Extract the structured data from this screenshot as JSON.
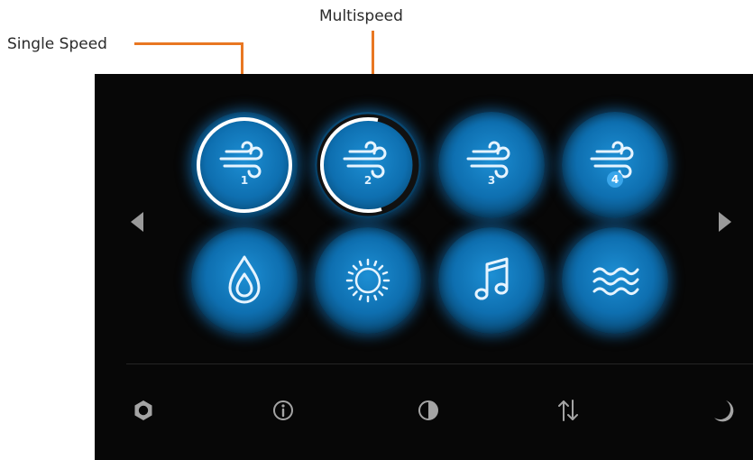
{
  "annotations": {
    "multispeed_label": "Multispeed",
    "single_speed_label": "Single Speed"
  },
  "grid": {
    "buttons": [
      {
        "icon": "wind-icon",
        "number": "1",
        "state": "selected-single-speed"
      },
      {
        "icon": "wind-icon",
        "number": "2",
        "state": "selected-multispeed"
      },
      {
        "icon": "wind-icon",
        "number": "3",
        "state": "normal"
      },
      {
        "icon": "wind-icon",
        "number": "4",
        "state": "normal-badge"
      },
      {
        "icon": "water-drop-icon",
        "state": "normal"
      },
      {
        "icon": "sun-icon",
        "state": "normal"
      },
      {
        "icon": "music-note-icon",
        "state": "normal"
      },
      {
        "icon": "waves-icon",
        "state": "normal"
      }
    ]
  },
  "navigation": {
    "left_icon": "triangle-left-icon",
    "right_icon": "triangle-right-icon"
  },
  "bottom_bar": {
    "icons": [
      "gear-icon",
      "info-icon",
      "contrast-icon",
      "up-down-arrows-icon",
      "moon-icon"
    ]
  },
  "colors": {
    "annotation_line": "#e87722",
    "screen_background": "#070707",
    "button_blue": "#0e6fb0",
    "glow": "#1682d2",
    "ring": "#ffffff",
    "icon_gray": "#a0a0a0"
  }
}
